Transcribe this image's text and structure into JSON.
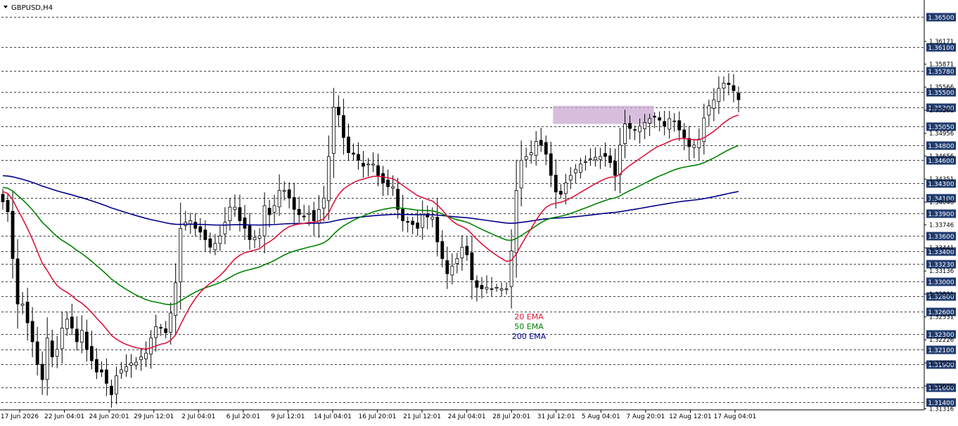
{
  "symbol": "GBPUSD,H4",
  "colors": {
    "ema20": "#dc143c",
    "ema50": "#008000",
    "ema200": "#00008b",
    "candle": "#000000",
    "zone": "#c8a8d0",
    "grid": "#000000",
    "level_box": "#1e3a6e"
  },
  "chart_data": {
    "type": "candlestick",
    "title": "GBPUSD,H4",
    "ylim": [
      1.313,
      1.367
    ],
    "x_labels": [
      "17 Jun 2026",
      "22 Jun 04:01",
      "24 Jun 20:01",
      "29 Jun 12:01",
      "2 Jul 04:01",
      "6 Jul 20:01",
      "9 Jul 12:01",
      "14 Jul 04:01",
      "16 Jul 20:01",
      "21 Jul 12:01",
      "24 Jul 04:01",
      "28 Jul 20:01",
      "31 Jul 12:01",
      "5 Aug 04:01",
      "7 Aug 20:01",
      "12 Aug 12:01",
      "17 Aug 04:01"
    ],
    "levels": [
      "1.36500",
      "1.36100",
      "1.35780",
      "1.35500",
      "1.35300",
      "1.35050",
      "1.34800",
      "1.34600",
      "1.34300",
      "1.34100",
      "1.33900",
      "1.33600",
      "1.33400",
      "1.33230",
      "1.33000",
      "1.32800",
      "1.32600",
      "1.32300",
      "1.32100",
      "1.31900",
      "1.31600",
      "1.31400"
    ],
    "axis_prices": [
      "1.36171",
      "1.35871",
      "1.35566",
      "1.35261",
      "1.34956",
      "1.34656",
      "1.34351",
      "1.34046",
      "1.33746",
      "1.33441",
      "1.33136",
      "1.32831",
      "1.32531",
      "1.32226",
      "1.31921",
      "1.31616",
      "1.31316"
    ],
    "zone": {
      "from_index": 112,
      "to_index": 131,
      "low": 1.3508,
      "high": 1.3532
    },
    "closes": [
      1.3405,
      1.3392,
      1.333,
      1.327,
      1.327,
      1.3245,
      1.322,
      1.319,
      1.317,
      1.3225,
      1.32,
      1.321,
      1.3238,
      1.325,
      1.3238,
      1.322,
      1.3235,
      1.321,
      1.3195,
      1.318,
      1.318,
      1.3165,
      1.315,
      1.3175,
      1.3183,
      1.3187,
      1.3192,
      1.3193,
      1.32,
      1.3205,
      1.3225,
      1.324,
      1.3238,
      1.3232,
      1.3258,
      1.3298,
      1.337,
      1.3378,
      1.338,
      1.337,
      1.3365,
      1.3355,
      1.3345,
      1.335,
      1.336,
      1.3378,
      1.3398,
      1.3398,
      1.338,
      1.337,
      1.3355,
      1.3358,
      1.336,
      1.34,
      1.3388,
      1.34,
      1.342,
      1.342,
      1.341,
      1.3395,
      1.3388,
      1.3385,
      1.339,
      1.338,
      1.3395,
      1.341,
      1.3465,
      1.353,
      1.352,
      1.349,
      1.347,
      1.3468,
      1.346,
      1.3452,
      1.3455,
      1.3455,
      1.344,
      1.343,
      1.3425,
      1.3425,
      1.3395,
      1.338,
      1.3378,
      1.3375,
      1.337,
      1.3388,
      1.3385,
      1.3385,
      1.3352,
      1.333,
      1.331,
      1.332,
      1.333,
      1.3345,
      1.3335,
      1.3302,
      1.3292,
      1.329,
      1.3292,
      1.329,
      1.3292,
      1.329,
      1.329,
      1.334,
      1.342,
      1.346,
      1.3465,
      1.347,
      1.3485,
      1.348,
      1.3468,
      1.344,
      1.3418,
      1.3415,
      1.343,
      1.344,
      1.3448,
      1.3455,
      1.3458,
      1.3462,
      1.3464,
      1.3465,
      1.3465,
      1.3457,
      1.344,
      1.348,
      1.3508,
      1.3502,
      1.35,
      1.3505,
      1.351,
      1.3515,
      1.3517,
      1.3513,
      1.3505,
      1.3515,
      1.3512,
      1.35,
      1.349,
      1.3478,
      1.348,
      1.3488,
      1.3516,
      1.3532,
      1.354,
      1.3555,
      1.3562,
      1.356,
      1.3552,
      1.354
    ],
    "series": [
      {
        "name": "20 EMA"
      },
      {
        "name": "50 EMA"
      },
      {
        "name": "200 EMA"
      }
    ]
  }
}
